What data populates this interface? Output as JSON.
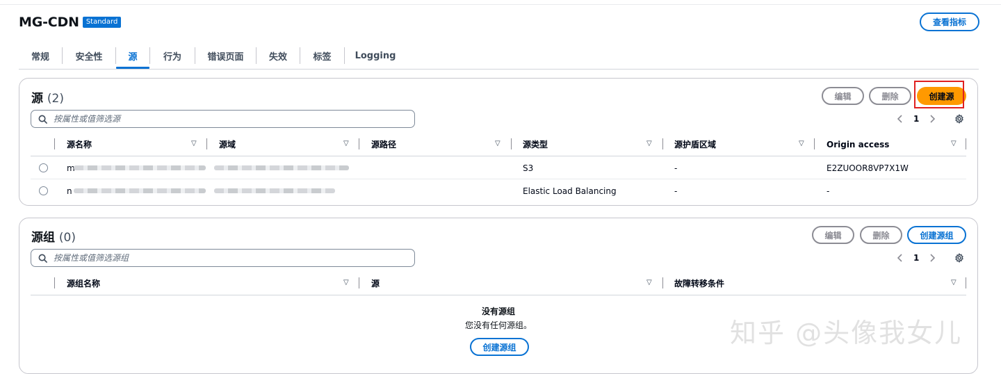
{
  "header": {
    "title": "MG-CDN",
    "badge": "Standard",
    "view_metrics_label": "查看指标"
  },
  "tabs": [
    {
      "label": "常规"
    },
    {
      "label": "安全性"
    },
    {
      "label": "源",
      "active": true
    },
    {
      "label": "行为"
    },
    {
      "label": "错误页面"
    },
    {
      "label": "失效"
    },
    {
      "label": "标签"
    },
    {
      "label": "Logging"
    }
  ],
  "origins": {
    "title": "源",
    "count": "(2)",
    "edit_label": "编辑",
    "delete_label": "删除",
    "create_label": "创建源",
    "search_placeholder": "按属性或值筛选源",
    "page": "1",
    "columns": [
      "源名称",
      "源域",
      "源路径",
      "源类型",
      "源护盾区域",
      "Origin access"
    ],
    "rows": [
      {
        "name": "m",
        "domain": "",
        "path": "",
        "type": "S3",
        "shield_region": "-",
        "access": "E2ZUOOR8VP7X1W"
      },
      {
        "name": "n",
        "domain": "",
        "path": "",
        "type": "Elastic Load Balancing",
        "shield_region": "-",
        "access": "-"
      }
    ]
  },
  "origin_groups": {
    "title": "源组",
    "count": "(0)",
    "edit_label": "编辑",
    "delete_label": "删除",
    "create_label": "创建源组",
    "search_placeholder": "按属性或值筛选源组",
    "page": "1",
    "columns": [
      "源组名称",
      "源",
      "故障转移条件"
    ],
    "empty_title": "没有源组",
    "empty_text": "您没有任何源组。",
    "empty_create_label": "创建源组"
  },
  "watermark": "知乎 @头像我女儿",
  "colors": {
    "accent": "#0972d3",
    "primary": "#ff9900",
    "highlight": "#e02020"
  },
  "icons": [
    "search-icon",
    "chevron-left-icon",
    "chevron-right-icon",
    "gear-icon",
    "sort-caret-icon"
  ]
}
